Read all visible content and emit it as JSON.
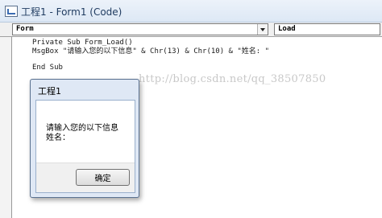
{
  "window": {
    "title": "工程1 - Form1 (Code)",
    "icon": "vb-code-window-icon"
  },
  "combos": {
    "object": "Form",
    "procedure": "Load"
  },
  "code": {
    "lines": [
      "Private Sub Form_Load()",
      "MsgBox \"请输入您的以下信息\" & Chr(13) & Chr(10) & \"姓名: \"",
      "",
      "End Sub"
    ]
  },
  "watermark": "http://blog.csdn.net/qq_38507850",
  "msgbox": {
    "title": "工程1",
    "line1": "请输入您的以下信息",
    "line2": "姓名：",
    "ok_label": "确定"
  }
}
